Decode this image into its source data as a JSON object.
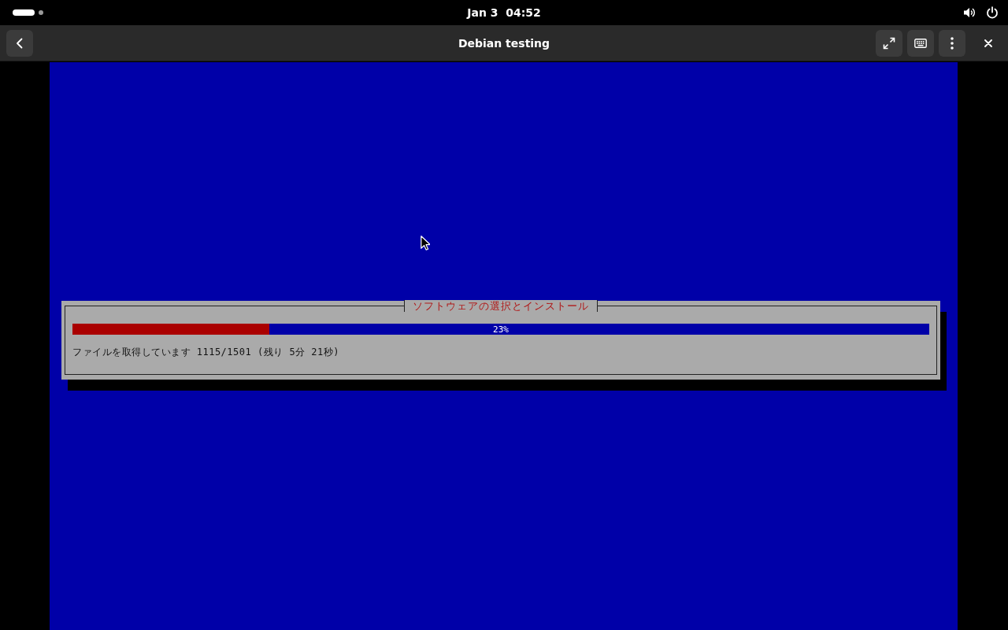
{
  "top_bar": {
    "clock": "Jan 3  04:52"
  },
  "header": {
    "title": "Debian testing"
  },
  "installer": {
    "dialog_title": "ソフトウェアの選択とインストール",
    "progress": {
      "level": 0.23,
      "label": "23%"
    },
    "status": "ファイルを取得しています 1115/1501 (残り 5分 21秒)"
  }
}
